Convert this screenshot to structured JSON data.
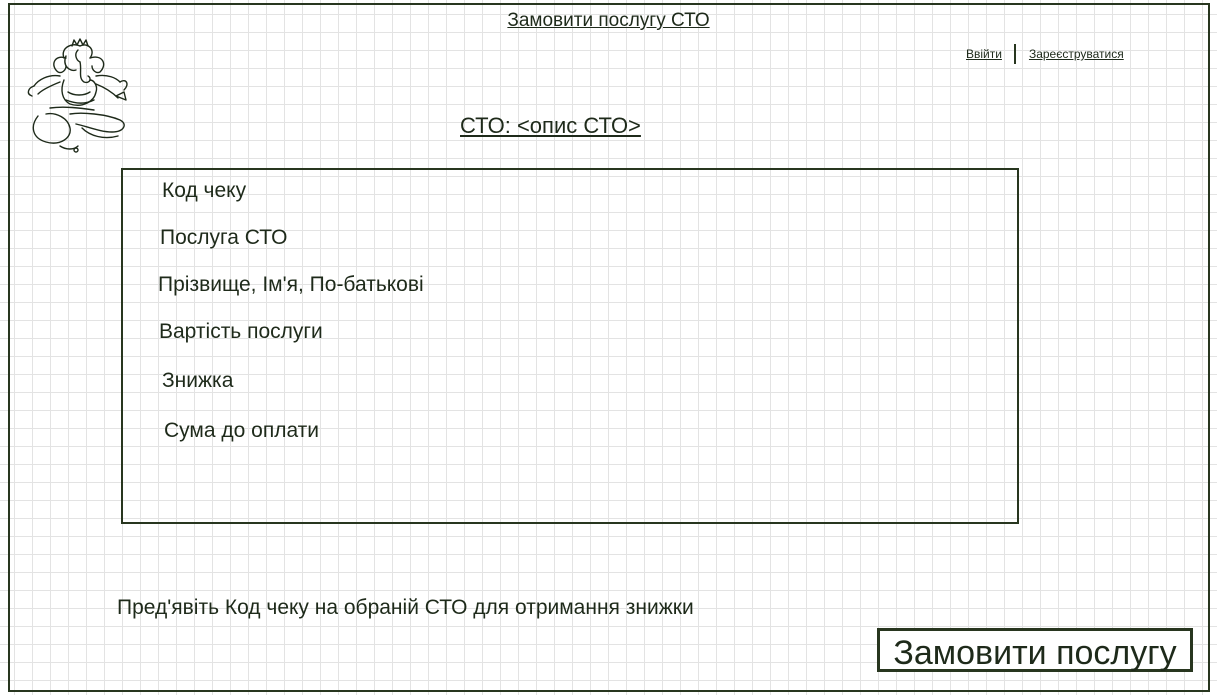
{
  "header": {
    "title": "Замовити послугу СТО",
    "login_label": "Ввійти",
    "register_label": "Зареєструватися"
  },
  "station": {
    "title": "СТО: <опис СТО>"
  },
  "receipt": {
    "fields": [
      "Код чеку",
      "Послуга СТО",
      "Прізвище, Ім'я, По-батькові",
      "Вартість послуги",
      "Знижка",
      "Сума до оплати"
    ]
  },
  "footer": {
    "hint": "Пред'явіть Код чеку на обраній СТО для отримання знижки",
    "order_button_label": "Замовити послугу"
  },
  "icons": {
    "logo": "ganesha-sketch-logo"
  },
  "colors": {
    "ink": "#1e2a1a",
    "border": "#28361f",
    "grid": "#e3e3e3"
  }
}
